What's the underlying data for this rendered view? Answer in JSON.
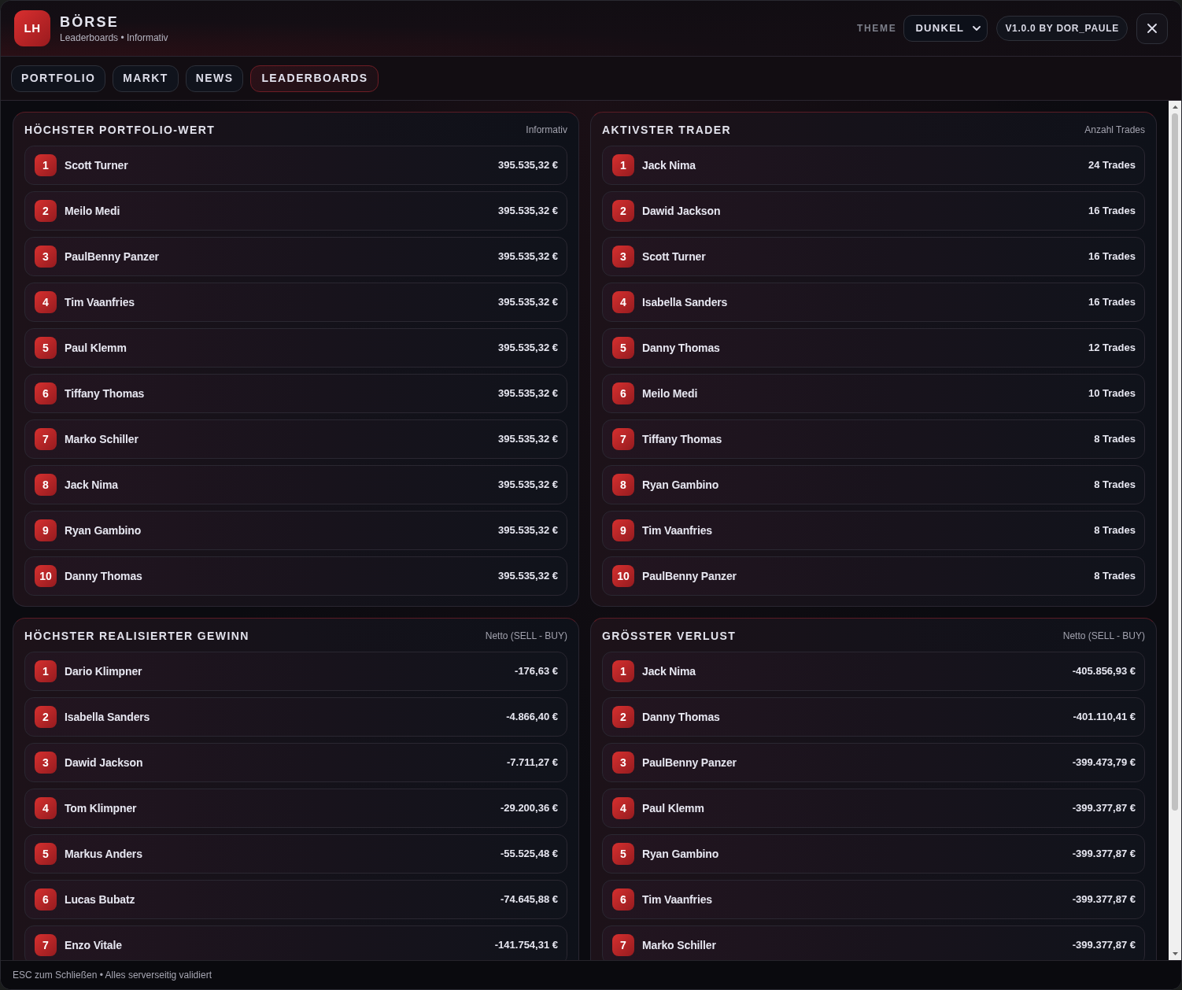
{
  "window": {
    "logo": "LH",
    "title": "BÖRSE",
    "subtitle": "Leaderboards • Informativ"
  },
  "header": {
    "theme_label": "THEME",
    "theme_select": {
      "value": "DUNKEL"
    },
    "version": "V1.0.0 BY DOR_PAULE"
  },
  "tabs": [
    {
      "label": "PORTFOLIO",
      "selected": false
    },
    {
      "label": "MARKT",
      "selected": false
    },
    {
      "label": "NEWS",
      "selected": false
    },
    {
      "label": "LEADERBOARDS",
      "selected": true
    }
  ],
  "boards": [
    {
      "title": "HÖCHSTER PORTFOLIO-WERT",
      "note": "Informativ",
      "rows": [
        {
          "rank": "1",
          "name": "Scott Turner",
          "value": "395.535,32 €"
        },
        {
          "rank": "2",
          "name": "Meilo Medi",
          "value": "395.535,32 €"
        },
        {
          "rank": "3",
          "name": "PaulBenny Panzer",
          "value": "395.535,32 €"
        },
        {
          "rank": "4",
          "name": "Tim Vaanfries",
          "value": "395.535,32 €"
        },
        {
          "rank": "5",
          "name": "Paul Klemm",
          "value": "395.535,32 €"
        },
        {
          "rank": "6",
          "name": "Tiffany Thomas",
          "value": "395.535,32 €"
        },
        {
          "rank": "7",
          "name": "Marko Schiller",
          "value": "395.535,32 €"
        },
        {
          "rank": "8",
          "name": "Jack Nima",
          "value": "395.535,32 €"
        },
        {
          "rank": "9",
          "name": "Ryan Gambino",
          "value": "395.535,32 €"
        },
        {
          "rank": "10",
          "name": "Danny Thomas",
          "value": "395.535,32 €"
        }
      ]
    },
    {
      "title": "AKTIVSTER TRADER",
      "note": "Anzahl Trades",
      "rows": [
        {
          "rank": "1",
          "name": "Jack Nima",
          "value": "24 Trades"
        },
        {
          "rank": "2",
          "name": "Dawid Jackson",
          "value": "16 Trades"
        },
        {
          "rank": "3",
          "name": "Scott Turner",
          "value": "16 Trades"
        },
        {
          "rank": "4",
          "name": "Isabella Sanders",
          "value": "16 Trades"
        },
        {
          "rank": "5",
          "name": "Danny Thomas",
          "value": "12 Trades"
        },
        {
          "rank": "6",
          "name": "Meilo Medi",
          "value": "10 Trades"
        },
        {
          "rank": "7",
          "name": "Tiffany Thomas",
          "value": "8 Trades"
        },
        {
          "rank": "8",
          "name": "Ryan Gambino",
          "value": "8 Trades"
        },
        {
          "rank": "9",
          "name": "Tim Vaanfries",
          "value": "8 Trades"
        },
        {
          "rank": "10",
          "name": "PaulBenny Panzer",
          "value": "8 Trades"
        }
      ]
    },
    {
      "title": "HÖCHSTER REALISIERTER GEWINN",
      "note": "Netto (SELL - BUY)",
      "rows": [
        {
          "rank": "1",
          "name": "Dario Klimpner",
          "value": "-176,63 €"
        },
        {
          "rank": "2",
          "name": "Isabella Sanders",
          "value": "-4.866,40 €"
        },
        {
          "rank": "3",
          "name": "Dawid Jackson",
          "value": "-7.711,27 €"
        },
        {
          "rank": "4",
          "name": "Tom Klimpner",
          "value": "-29.200,36 €"
        },
        {
          "rank": "5",
          "name": "Markus Anders",
          "value": "-55.525,48 €"
        },
        {
          "rank": "6",
          "name": "Lucas Bubatz",
          "value": "-74.645,88 €"
        },
        {
          "rank": "7",
          "name": "Enzo Vitale",
          "value": "-141.754,31 €"
        }
      ]
    },
    {
      "title": "GRÖSSTER VERLUST",
      "note": "Netto (SELL - BUY)",
      "rows": [
        {
          "rank": "1",
          "name": "Jack Nima",
          "value": "-405.856,93 €"
        },
        {
          "rank": "2",
          "name": "Danny Thomas",
          "value": "-401.110,41 €"
        },
        {
          "rank": "3",
          "name": "PaulBenny Panzer",
          "value": "-399.473,79 €"
        },
        {
          "rank": "4",
          "name": "Paul Klemm",
          "value": "-399.377,87 €"
        },
        {
          "rank": "5",
          "name": "Ryan Gambino",
          "value": "-399.377,87 €"
        },
        {
          "rank": "6",
          "name": "Tim Vaanfries",
          "value": "-399.377,87 €"
        },
        {
          "rank": "7",
          "name": "Marko Schiller",
          "value": "-399.377,87 €"
        }
      ]
    }
  ],
  "status_bar": "ESC zum Schließen • Alles serverseitig validiert"
}
